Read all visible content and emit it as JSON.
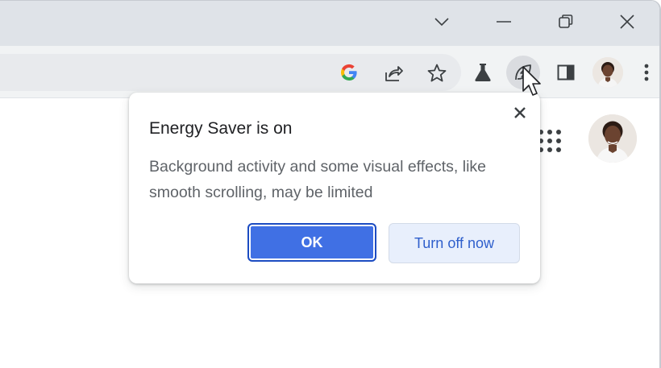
{
  "window_controls": {
    "tab_search": "chevron-down-icon",
    "minimize": "minimize-icon",
    "restore": "restore-icon",
    "close": "close-icon"
  },
  "toolbar": {
    "icons": [
      "google-icon",
      "share-icon",
      "star-icon",
      "labs-flask-icon",
      "energy-saver-icon",
      "side-panel-icon",
      "profile-avatar",
      "more-menu-icon"
    ]
  },
  "bubble": {
    "title": "Energy Saver is on",
    "body": "Background activity and some visual effects, like smooth scrolling, may be limited",
    "ok_label": "OK",
    "turn_off_label": "Turn off now"
  },
  "colors": {
    "accent": "#4070e4",
    "titlebar": "#dfe3e8",
    "toolbar": "#f1f3f4",
    "secondary_button": "#e8effc"
  }
}
